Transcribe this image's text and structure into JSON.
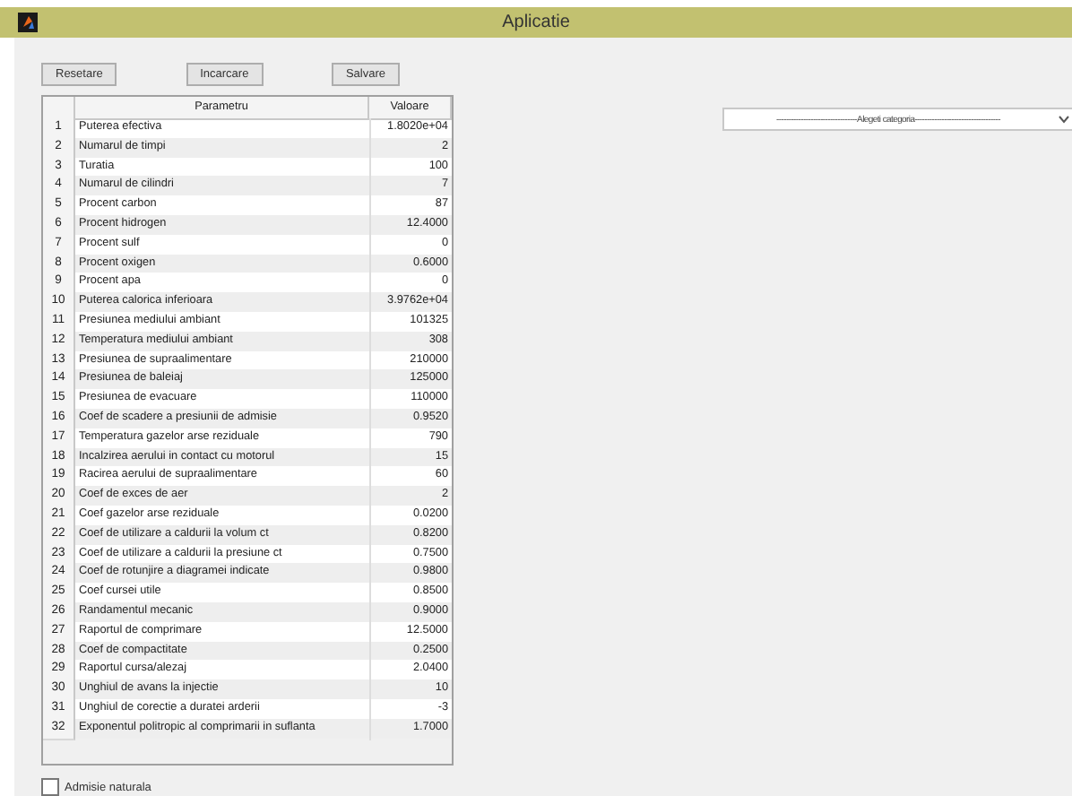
{
  "window": {
    "title": "Aplicatie"
  },
  "buttons": [
    "Resetare",
    "Incarcare",
    "Salvare"
  ],
  "table": {
    "columns": [
      "Parametru",
      "Valoare"
    ],
    "rows": [
      {
        "index": "1",
        "name": "Puterea efectiva",
        "value": "1.8020e+04"
      },
      {
        "index": "2",
        "name": "Numarul de timpi",
        "value": "2"
      },
      {
        "index": "3",
        "name": "Turatia",
        "value": "100"
      },
      {
        "index": "4",
        "name": "Numarul de cilindri",
        "value": "7"
      },
      {
        "index": "5",
        "name": "Procent carbon",
        "value": "87"
      },
      {
        "index": "6",
        "name": "Procent hidrogen",
        "value": "12.4000"
      },
      {
        "index": "7",
        "name": "Procent sulf",
        "value": "0"
      },
      {
        "index": "8",
        "name": "Procent oxigen",
        "value": "0.6000"
      },
      {
        "index": "9",
        "name": "Procent apa",
        "value": "0"
      },
      {
        "index": "10",
        "name": "Puterea calorica inferioara",
        "value": "3.9762e+04"
      },
      {
        "index": "11",
        "name": "Presiunea mediului ambiant",
        "value": "101325"
      },
      {
        "index": "12",
        "name": "Temperatura mediului ambiant",
        "value": "308"
      },
      {
        "index": "13",
        "name": "Presiunea de supraalimentare",
        "value": "210000"
      },
      {
        "index": "14",
        "name": "Presiunea de baleiaj",
        "value": "125000"
      },
      {
        "index": "15",
        "name": "Presiunea de evacuare",
        "value": "110000"
      },
      {
        "index": "16",
        "name": "Coef de scadere a presiunii de admisie",
        "value": "0.9520"
      },
      {
        "index": "17",
        "name": "Temperatura gazelor arse reziduale",
        "value": "790"
      },
      {
        "index": "18",
        "name": "Incalzirea aerului in contact cu motorul",
        "value": "15"
      },
      {
        "index": "19",
        "name": "Racirea aerului de supraalimentare",
        "value": "60"
      },
      {
        "index": "20",
        "name": "Coef de exces de aer",
        "value": "2"
      },
      {
        "index": "21",
        "name": "Coef gazelor arse reziduale",
        "value": "0.0200"
      },
      {
        "index": "22",
        "name": "Coef de utilizare a caldurii la volum ct",
        "value": "0.8200"
      },
      {
        "index": "23",
        "name": "Coef de utilizare a caldurii la presiune ct",
        "value": "0.7500"
      },
      {
        "index": "24",
        "name": "Coef de rotunjire a diagramei indicate",
        "value": "0.9800"
      },
      {
        "index": "25",
        "name": "Coef cursei utile",
        "value": "0.8500"
      },
      {
        "index": "26",
        "name": "Randamentul mecanic",
        "value": "0.9000"
      },
      {
        "index": "27",
        "name": "Raportul de comprimare",
        "value": "12.5000"
      },
      {
        "index": "28",
        "name": "Coef de compactitate",
        "value": "0.2500"
      },
      {
        "index": "29",
        "name": "Raportul cursa/alezaj",
        "value": "2.0400"
      },
      {
        "index": "30",
        "name": "Unghiul de avans la injectie",
        "value": "10"
      },
      {
        "index": "31",
        "name": "Unghiul de corectie a duratei arderii",
        "value": "-3"
      },
      {
        "index": "32",
        "name": "Exponentul politropic al comprimarii in suflanta",
        "value": "1.7000"
      }
    ]
  },
  "category_dropdown": {
    "placeholder": "---------------------------------Alegeti categoria-----------------------------------"
  },
  "checkbox": {
    "label": "Admisie naturala",
    "checked": false
  }
}
